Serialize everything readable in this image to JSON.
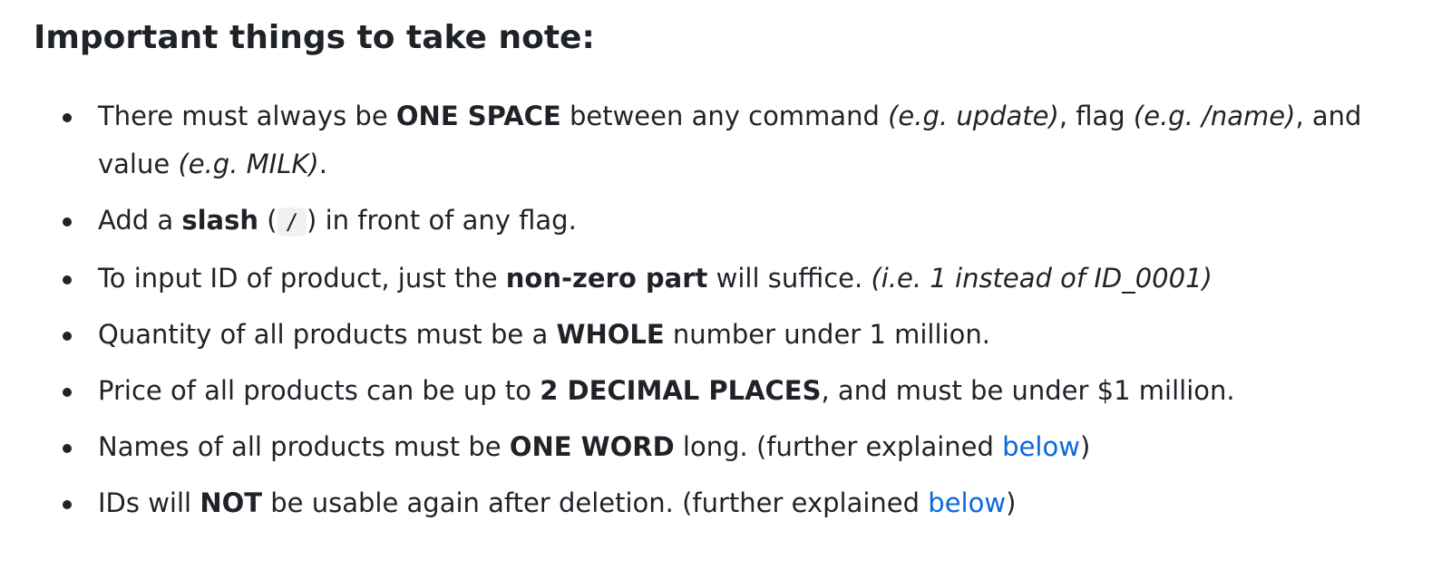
{
  "heading": "Important things to take note:",
  "notes": [
    {
      "p1": "There must always be ",
      "b1": "ONE SPACE",
      "p2": " between any command ",
      "i1": "(e.g. update)",
      "p3": ", flag ",
      "i2": "(e.g. /name)",
      "p4": ", and value ",
      "i3": "(e.g. MILK)",
      "p5": "."
    },
    {
      "p1": "Add a ",
      "b1": "slash",
      "p2": " (",
      "code": "/",
      "p3": ") in front of any flag."
    },
    {
      "p1": "To input ID of product, just the ",
      "b1": "non-zero part",
      "p2": " will suffice. ",
      "i1": "(i.e. 1 instead of ID_0001)"
    },
    {
      "p1": "Quantity of all products must be a ",
      "b1": "WHOLE",
      "p2": " number under 1 million."
    },
    {
      "p1": "Price of all products can be up to ",
      "b1": "2 DECIMAL PLACES",
      "p2": ", and must be under $1 million."
    },
    {
      "p1": "Names of all products must be ",
      "b1": "ONE WORD",
      "p2": " long. (further explained ",
      "link": "below",
      "p3": ")"
    },
    {
      "p1": "IDs will ",
      "b1": "NOT",
      "p2": " be usable again after deletion. (further explained ",
      "link": "below",
      "p3": ")"
    }
  ],
  "colors": {
    "text": "#1f2328",
    "link": "#0969da",
    "code_background": "#eff1f3"
  }
}
